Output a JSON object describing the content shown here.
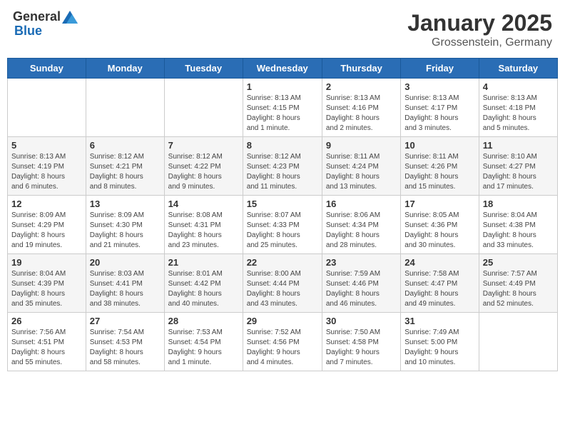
{
  "header": {
    "logo_general": "General",
    "logo_blue": "Blue",
    "month": "January 2025",
    "location": "Grossenstein, Germany"
  },
  "weekdays": [
    "Sunday",
    "Monday",
    "Tuesday",
    "Wednesday",
    "Thursday",
    "Friday",
    "Saturday"
  ],
  "weeks": [
    [
      {
        "day": "",
        "info": ""
      },
      {
        "day": "",
        "info": ""
      },
      {
        "day": "",
        "info": ""
      },
      {
        "day": "1",
        "info": "Sunrise: 8:13 AM\nSunset: 4:15 PM\nDaylight: 8 hours\nand 1 minute."
      },
      {
        "day": "2",
        "info": "Sunrise: 8:13 AM\nSunset: 4:16 PM\nDaylight: 8 hours\nand 2 minutes."
      },
      {
        "day": "3",
        "info": "Sunrise: 8:13 AM\nSunset: 4:17 PM\nDaylight: 8 hours\nand 3 minutes."
      },
      {
        "day": "4",
        "info": "Sunrise: 8:13 AM\nSunset: 4:18 PM\nDaylight: 8 hours\nand 5 minutes."
      }
    ],
    [
      {
        "day": "5",
        "info": "Sunrise: 8:13 AM\nSunset: 4:19 PM\nDaylight: 8 hours\nand 6 minutes."
      },
      {
        "day": "6",
        "info": "Sunrise: 8:12 AM\nSunset: 4:21 PM\nDaylight: 8 hours\nand 8 minutes."
      },
      {
        "day": "7",
        "info": "Sunrise: 8:12 AM\nSunset: 4:22 PM\nDaylight: 8 hours\nand 9 minutes."
      },
      {
        "day": "8",
        "info": "Sunrise: 8:12 AM\nSunset: 4:23 PM\nDaylight: 8 hours\nand 11 minutes."
      },
      {
        "day": "9",
        "info": "Sunrise: 8:11 AM\nSunset: 4:24 PM\nDaylight: 8 hours\nand 13 minutes."
      },
      {
        "day": "10",
        "info": "Sunrise: 8:11 AM\nSunset: 4:26 PM\nDaylight: 8 hours\nand 15 minutes."
      },
      {
        "day": "11",
        "info": "Sunrise: 8:10 AM\nSunset: 4:27 PM\nDaylight: 8 hours\nand 17 minutes."
      }
    ],
    [
      {
        "day": "12",
        "info": "Sunrise: 8:09 AM\nSunset: 4:29 PM\nDaylight: 8 hours\nand 19 minutes."
      },
      {
        "day": "13",
        "info": "Sunrise: 8:09 AM\nSunset: 4:30 PM\nDaylight: 8 hours\nand 21 minutes."
      },
      {
        "day": "14",
        "info": "Sunrise: 8:08 AM\nSunset: 4:31 PM\nDaylight: 8 hours\nand 23 minutes."
      },
      {
        "day": "15",
        "info": "Sunrise: 8:07 AM\nSunset: 4:33 PM\nDaylight: 8 hours\nand 25 minutes."
      },
      {
        "day": "16",
        "info": "Sunrise: 8:06 AM\nSunset: 4:34 PM\nDaylight: 8 hours\nand 28 minutes."
      },
      {
        "day": "17",
        "info": "Sunrise: 8:05 AM\nSunset: 4:36 PM\nDaylight: 8 hours\nand 30 minutes."
      },
      {
        "day": "18",
        "info": "Sunrise: 8:04 AM\nSunset: 4:38 PM\nDaylight: 8 hours\nand 33 minutes."
      }
    ],
    [
      {
        "day": "19",
        "info": "Sunrise: 8:04 AM\nSunset: 4:39 PM\nDaylight: 8 hours\nand 35 minutes."
      },
      {
        "day": "20",
        "info": "Sunrise: 8:03 AM\nSunset: 4:41 PM\nDaylight: 8 hours\nand 38 minutes."
      },
      {
        "day": "21",
        "info": "Sunrise: 8:01 AM\nSunset: 4:42 PM\nDaylight: 8 hours\nand 40 minutes."
      },
      {
        "day": "22",
        "info": "Sunrise: 8:00 AM\nSunset: 4:44 PM\nDaylight: 8 hours\nand 43 minutes."
      },
      {
        "day": "23",
        "info": "Sunrise: 7:59 AM\nSunset: 4:46 PM\nDaylight: 8 hours\nand 46 minutes."
      },
      {
        "day": "24",
        "info": "Sunrise: 7:58 AM\nSunset: 4:47 PM\nDaylight: 8 hours\nand 49 minutes."
      },
      {
        "day": "25",
        "info": "Sunrise: 7:57 AM\nSunset: 4:49 PM\nDaylight: 8 hours\nand 52 minutes."
      }
    ],
    [
      {
        "day": "26",
        "info": "Sunrise: 7:56 AM\nSunset: 4:51 PM\nDaylight: 8 hours\nand 55 minutes."
      },
      {
        "day": "27",
        "info": "Sunrise: 7:54 AM\nSunset: 4:53 PM\nDaylight: 8 hours\nand 58 minutes."
      },
      {
        "day": "28",
        "info": "Sunrise: 7:53 AM\nSunset: 4:54 PM\nDaylight: 9 hours\nand 1 minute."
      },
      {
        "day": "29",
        "info": "Sunrise: 7:52 AM\nSunset: 4:56 PM\nDaylight: 9 hours\nand 4 minutes."
      },
      {
        "day": "30",
        "info": "Sunrise: 7:50 AM\nSunset: 4:58 PM\nDaylight: 9 hours\nand 7 minutes."
      },
      {
        "day": "31",
        "info": "Sunrise: 7:49 AM\nSunset: 5:00 PM\nDaylight: 9 hours\nand 10 minutes."
      },
      {
        "day": "",
        "info": ""
      }
    ]
  ]
}
